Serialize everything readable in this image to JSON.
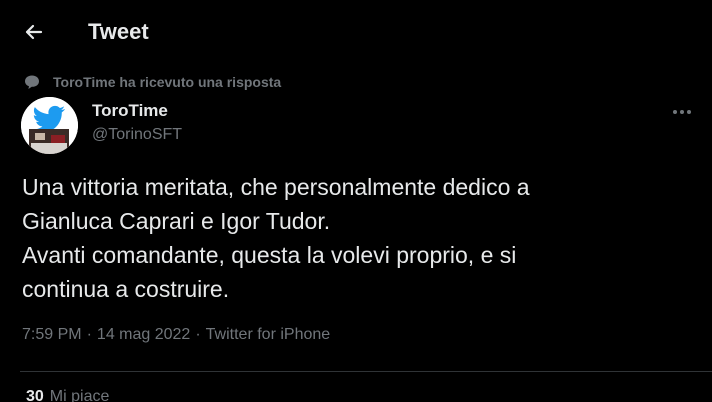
{
  "header": {
    "title": "Tweet",
    "back_icon": "arrow-left-icon"
  },
  "context": {
    "icon": "speech-bubble-icon",
    "text": "ToroTime ha ricevuto una risposta"
  },
  "author": {
    "name": "ToroTime",
    "handle": "@TorinoSFT",
    "avatar_icon": "twitter-bird-icon"
  },
  "tweet": {
    "text": "Una vittoria meritata, che personalmente dedico a\nGianluca Caprari e Igor Tudor.\nAvanti comandante, questa la volevi proprio, e si\ncontinua a costruire."
  },
  "meta": {
    "time": "7:59 PM",
    "date": "14 mag 2022",
    "separator": "·",
    "source": "Twitter for iPhone"
  },
  "stats": {
    "likes_count": "30",
    "likes_label": "Mi piace"
  },
  "colors": {
    "background": "#000000",
    "text_primary": "#e7e9ea",
    "text_secondary": "#71767b",
    "divider": "#2f3336",
    "twitter_blue": "#1d9bf0"
  }
}
